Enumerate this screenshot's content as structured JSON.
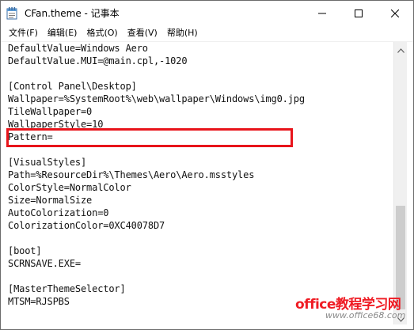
{
  "window": {
    "title": "CFan.theme - 记事本"
  },
  "menu": [
    {
      "label": "文件(F)"
    },
    {
      "label": "编辑(E)"
    },
    {
      "label": "格式(O)"
    },
    {
      "label": "查看(V)"
    },
    {
      "label": "帮助(H)"
    }
  ],
  "editor": {
    "lines": [
      "DefaultValue=Windows Aero",
      "DefaultValue.MUI=@main.cpl,-1020",
      "",
      "[Control Panel\\Desktop]",
      "Wallpaper=%SystemRoot%\\web\\wallpaper\\Windows\\img0.jpg",
      "TileWallpaper=0",
      "WallpaperStyle=10",
      "Pattern=",
      "",
      "[VisualStyles]",
      "Path=%ResourceDir%\\Themes\\Aero\\Aero.msstyles",
      "ColorStyle=NormalColor",
      "Size=NormalSize",
      "AutoColorization=0",
      "ColorizationColor=0XC40078D7",
      "",
      "[boot]",
      "SCRNSAVE.EXE=",
      "",
      "[MasterThemeSelector]",
      "MTSM=RJSPBS"
    ],
    "highlighted_line_index": 10
  },
  "watermark": {
    "title": "office教程学习网",
    "url": "www.office68.com"
  },
  "colors": {
    "highlight_border": "#e8141b",
    "watermark_red": "#ef1c24"
  },
  "icons": {
    "app": "notepad-icon",
    "minimize": "minimize-icon",
    "maximize": "maximize-icon",
    "close": "close-icon",
    "scroll_up": "chevron-up-icon",
    "scroll_down": "chevron-down-icon"
  }
}
